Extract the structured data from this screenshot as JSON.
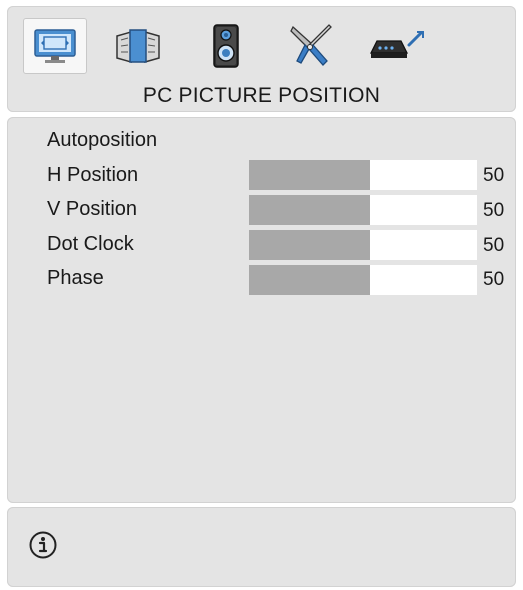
{
  "header": {
    "title": "PC PICTURE POSITION",
    "tabs": [
      {
        "icon": "monitor-icon",
        "selected": true
      },
      {
        "icon": "picture-frames-icon",
        "selected": false
      },
      {
        "icon": "speaker-icon",
        "selected": false
      },
      {
        "icon": "tools-icon",
        "selected": false
      },
      {
        "icon": "satellite-receiver-icon",
        "selected": false
      }
    ]
  },
  "menu": {
    "autoposition_label": "Autoposition",
    "items": [
      {
        "label": "H Position",
        "value": "50",
        "level": 0.53
      },
      {
        "label": "V Position",
        "value": "50",
        "level": 0.53
      },
      {
        "label": "Dot Clock",
        "value": "50",
        "level": 0.53
      },
      {
        "label": "Phase",
        "value": "50",
        "level": 0.53
      }
    ]
  },
  "footer": {
    "icon": "info-icon"
  },
  "colors": {
    "panel": "#e4e4e4",
    "slider_fill": "#a8a8a8",
    "slider_track": "#ffffff",
    "icon_blue": "#3d86c6"
  }
}
